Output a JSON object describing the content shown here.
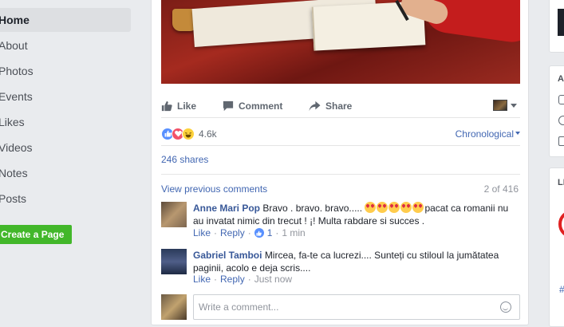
{
  "left_nav": {
    "items": [
      "Home",
      "About",
      "Photos",
      "Events",
      "Likes",
      "Videos",
      "Notes",
      "Posts"
    ],
    "active_index": 0,
    "create_page_label": "Create a Page"
  },
  "post": {
    "actions": {
      "like": "Like",
      "comment": "Comment",
      "share": "Share"
    },
    "reactions_count": "4.6k",
    "sort_label": "Chronological",
    "shares_label": "246 shares",
    "view_previous": "View previous comments",
    "pagination": "2 of 416",
    "comments": [
      {
        "author": "Anne Mari Pop",
        "text_before": "Bravo . bravo. bravo.....",
        "text_after": "pacat ca romanii nu au invatat nimic din trecut ! ¡! Multa rabdare si succes .",
        "emoji": "heart-eyes-emoji",
        "emoji_count": 5,
        "like_label": "Like",
        "reply_label": "Reply",
        "likes": "1",
        "time": "1 min"
      },
      {
        "author": "Gabriel Tamboi",
        "text_before": "Mircea, fa-te ca lucrezi.... Sunteți cu stiloul la jumătatea paginii, acolo e deja scris....",
        "text_after": "",
        "like_label": "Like",
        "reply_label": "Reply",
        "time": "Just now"
      }
    ],
    "write_placeholder": "Write a comment..."
  },
  "right_col": {
    "letter_a": "A",
    "letter_li": "LI"
  },
  "colors": {
    "link": "#4267b2",
    "create_button": "#42b72a",
    "active_nav_bg": "#dddfe2"
  }
}
